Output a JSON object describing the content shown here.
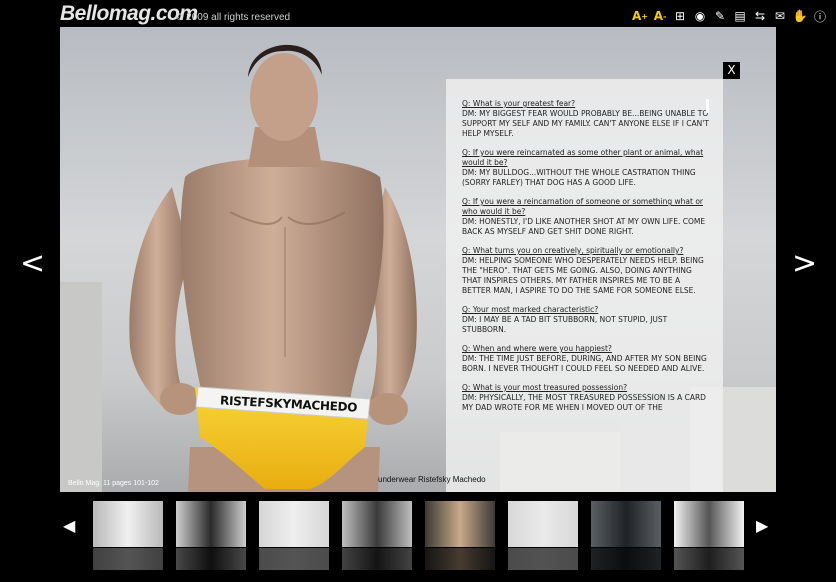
{
  "header": {
    "logo": "Bellomag.com",
    "copyright": "© 2009 all rights reserved",
    "tools": [
      {
        "name": "font-increase-icon",
        "glyph": "A",
        "sup": "+"
      },
      {
        "name": "font-decrease-icon",
        "glyph": "A",
        "sup": "-"
      },
      {
        "name": "grid-icon",
        "glyph": "⊞"
      },
      {
        "name": "rss-icon",
        "glyph": "◉"
      },
      {
        "name": "pin-icon",
        "glyph": "✎"
      },
      {
        "name": "print-icon",
        "glyph": "▤"
      },
      {
        "name": "swap-icon",
        "glyph": "⇆"
      },
      {
        "name": "email-icon",
        "glyph": "✉"
      },
      {
        "name": "hand-icon",
        "glyph": "✋"
      },
      {
        "name": "info-icon",
        "glyph": "ⓘ"
      }
    ]
  },
  "stage": {
    "close_label": "X",
    "page_info": "Bello Mag: 11 pages 101-102",
    "caption": "underwear Ristefsky Machedo",
    "waistband_text": "RISTEFSKYMACHEDO",
    "nav_prev": "<",
    "nav_next": ">"
  },
  "interview": [
    {
      "q": "Q: What is your greatest fear?",
      "a": "DM: MY BIGGEST FEAR WOULD PROBABLY BE...BEING UNABLE TO SUPPORT MY SELF AND MY FAMILY. CAN'T ANYONE ELSE IF I CAN'T HELP MYSELF."
    },
    {
      "q": "Q: If you were reincarnated as some other plant or animal, what would it be?",
      "a": "DM: MY BULLDOG...WITHOUT THE WHOLE CASTRATION THING (SORRY FARLEY) THAT DOG HAS A GOOD LIFE."
    },
    {
      "q": "Q: If you were a reincarnation of someone or something what or who would it be?",
      "a": "DM: HONESTLY, I'D LIKE ANOTHER SHOT AT MY OWN LIFE. COME BACK AS MYSELF AND GET SHIT DONE RIGHT."
    },
    {
      "q": "Q: What turns you on creatively, spiritually or emotionally?",
      "a": "DM: HELPING SOMEONE WHO DESPERATELY NEEDS HELP. BEING THE \"HERO\". THAT GETS ME GOING. ALSO, DOING ANYTHING THAT INSPIRES OTHERS. MY FATHER INSPIRES ME TO BE A BETTER MAN, I ASPIRE TO DO THE SAME FOR SOMEONE ELSE."
    },
    {
      "q": "Q: Your most marked characteristic?",
      "a": "DM: I MAY BE A TAD BIT STUBBORN, NOT STUPID, JUST STUBBORN."
    },
    {
      "q": "Q: When and where were you happiest?",
      "a": "DM: THE TIME JUST BEFORE, DURING, AND AFTER MY SON BEING BORN. I NEVER THOUGHT I COULD FEEL SO NEEDED AND ALIVE."
    },
    {
      "q": "Q: What is your most treasured possession?",
      "a": "DM: PHYSICALLY, THE MOST TREASURED POSSESSION IS A CARD MY DAD WROTE FOR ME WHEN I MOVED OUT OF THE"
    }
  ],
  "thumbnails": {
    "prev": "◀",
    "next": "▶",
    "items": [
      {
        "tone": "#b9b9b9",
        "accent": "#f0f0f0"
      },
      {
        "tone": "#cfcfcf",
        "accent": "#2a2a2a"
      },
      {
        "tone": "#d6d6d6",
        "accent": "#efefef"
      },
      {
        "tone": "#bfbfbf",
        "accent": "#3a3a3a"
      },
      {
        "tone": "#3d3a36",
        "accent": "#c9a98a"
      },
      {
        "tone": "#d8d8d8",
        "accent": "#eaeaea"
      },
      {
        "tone": "#5a5f63",
        "accent": "#1f2327"
      },
      {
        "tone": "#f2f2f2",
        "accent": "#555"
      }
    ]
  },
  "colors": {
    "accent_yellow": "#f4d000",
    "underwear_yellow": "#f2c21a"
  }
}
